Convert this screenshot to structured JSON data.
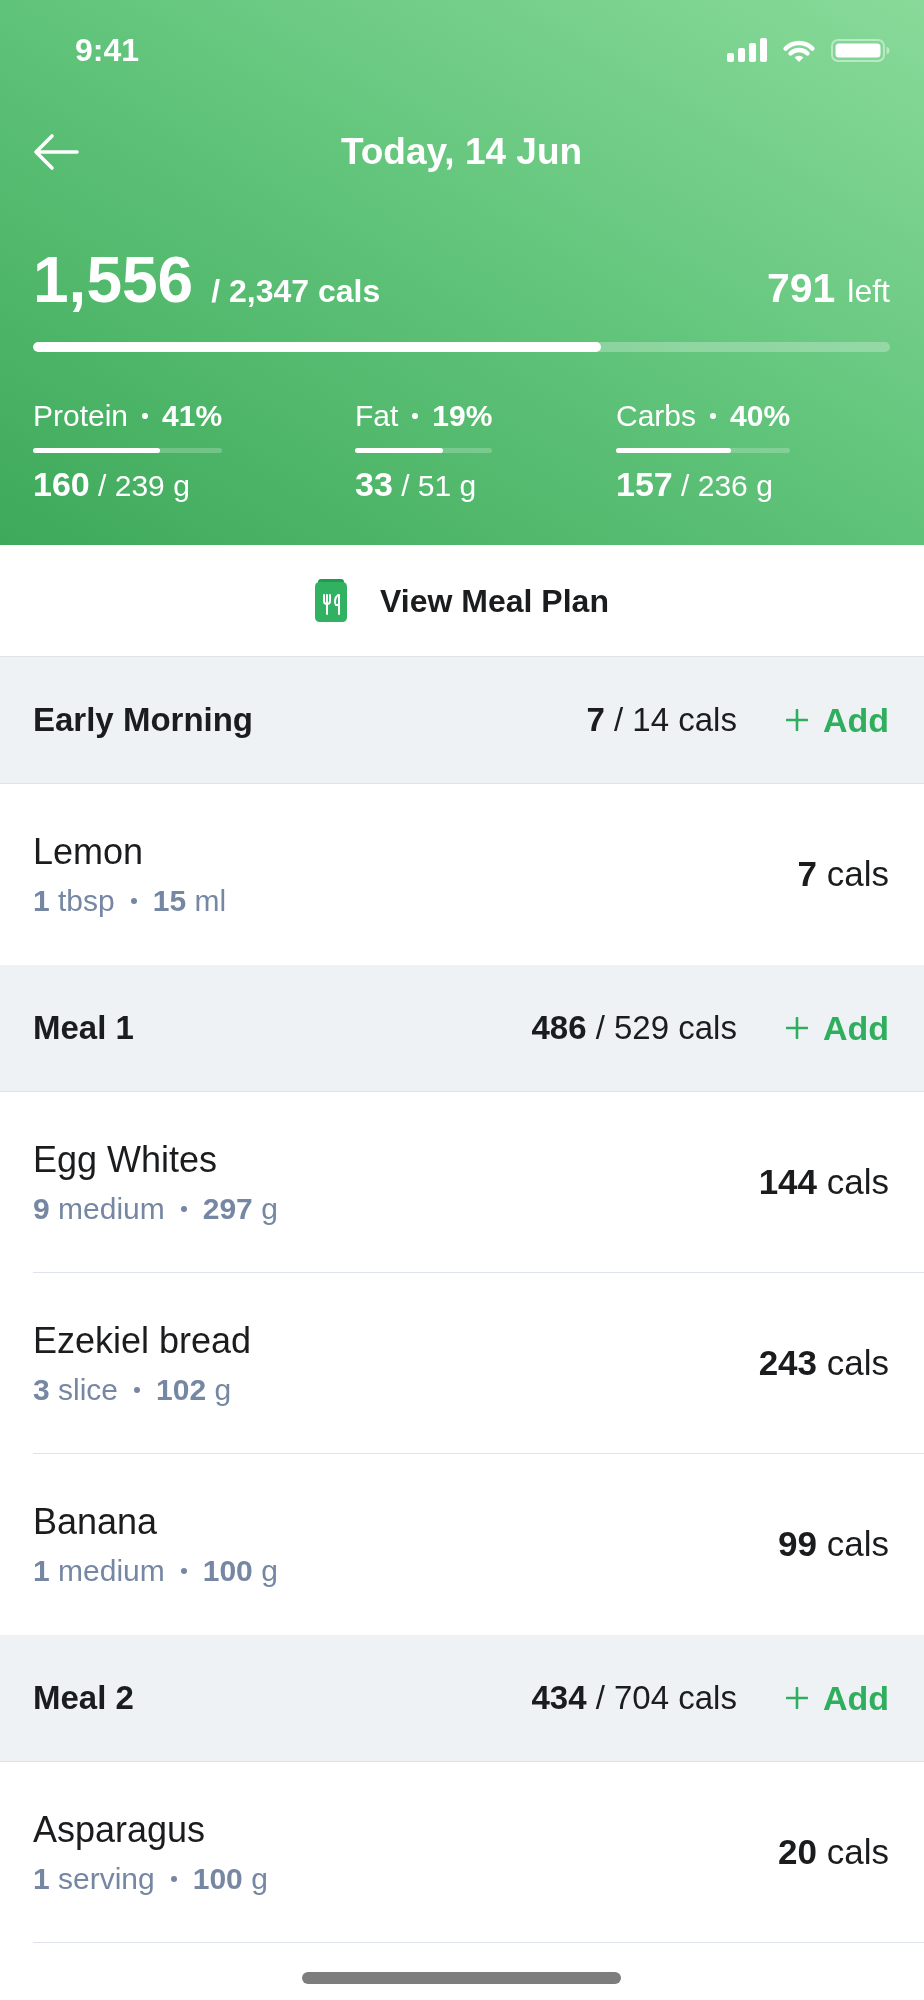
{
  "status_bar": {
    "time": "9:41"
  },
  "header": {
    "title": "Today, 14 Jun"
  },
  "summary": {
    "consumed": "1,556",
    "target": "/ 2,347 cals",
    "remaining": "791",
    "remaining_label": "left",
    "level": 0.663
  },
  "macros": [
    {
      "label": "Protein",
      "percent": "41%",
      "amount": "**160** / 239 g",
      "level": 0.67
    },
    {
      "label": "Fat",
      "percent": "19%",
      "amount": "**33** / 51 g",
      "level": 0.64
    },
    {
      "label": "Carbs",
      "percent": "40%",
      "amount": "**157** / 236 g",
      "level": 0.66
    }
  ],
  "meal_plan_button": {
    "label": "View Meal Plan"
  },
  "meals": [
    {
      "name": "Early Morning",
      "calories": "**7** / 14 cals",
      "add_label": "Add",
      "items": [
        {
          "name": "Lemon",
          "serving": "**1** tbsp",
          "weight": "**15** ml",
          "calories": "**7** cals"
        }
      ]
    },
    {
      "name": "Meal 1",
      "calories": "**486** / 529 cals",
      "add_label": "Add",
      "items": [
        {
          "name": "Egg Whites",
          "serving": "**9** medium",
          "weight": "**297** g",
          "calories": "**144** cals"
        },
        {
          "name": "Ezekiel bread",
          "serving": "**3** slice",
          "weight": "**102** g",
          "calories": "**243** cals"
        },
        {
          "name": "Banana",
          "serving": "**1** medium",
          "weight": "**100** g",
          "calories": "**99** cals"
        }
      ]
    },
    {
      "name": "Meal 2",
      "calories": "**434** / 704 cals",
      "add_label": "Add",
      "items": [
        {
          "name": "Asparagus",
          "serving": "**1** serving",
          "weight": "**100** g",
          "calories": "**20** cals"
        }
      ]
    }
  ]
}
